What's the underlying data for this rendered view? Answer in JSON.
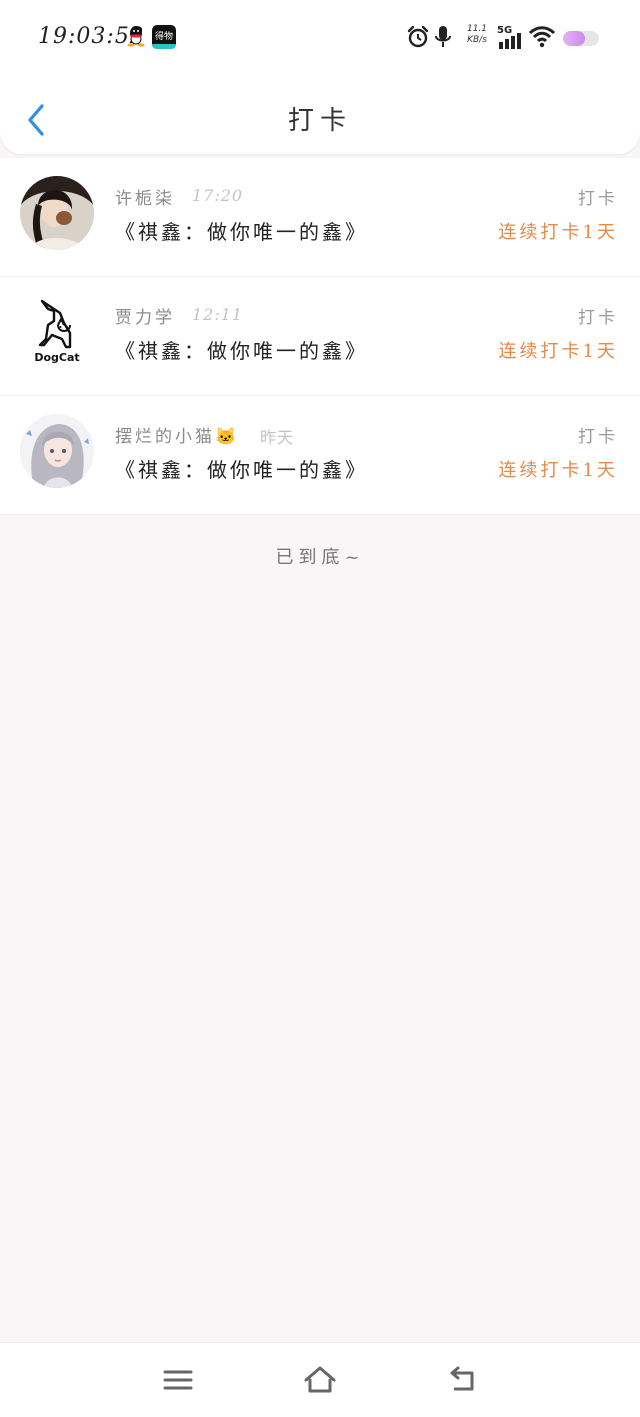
{
  "status_bar": {
    "time": "19:03:52",
    "app_icon_label": "得物",
    "net_speed_value": "11.1",
    "net_speed_unit": "KB/s",
    "network": "5G",
    "battery_level": 0.6
  },
  "header": {
    "title": "打卡"
  },
  "checkins": [
    {
      "name": "许栀柒",
      "time": "17:20",
      "message": "《祺鑫：做你唯一的鑫》",
      "action": "打卡",
      "streak": "连续打卡1天",
      "avatar": "photo-avatar"
    },
    {
      "name": "贾力学",
      "time": "12:11",
      "message": "《祺鑫：做你唯一的鑫》",
      "action": "打卡",
      "streak": "连续打卡1天",
      "avatar": "dogcat-logo-avatar",
      "avatar_text": "DogCat"
    },
    {
      "name": "摆烂的小猫🐱",
      "time": "昨天",
      "message": "《祺鑫：做你唯一的鑫》",
      "action": "打卡",
      "streak": "连续打卡1天",
      "avatar": "anime-girl-avatar"
    }
  ],
  "end_text": "已到底~",
  "colors": {
    "accent_back": "#2f8fe0",
    "streak": "#e28a4a",
    "background": "#f8f6f7"
  },
  "nav": {
    "menu": "menu-icon",
    "home": "home-icon",
    "back": "back-icon"
  }
}
